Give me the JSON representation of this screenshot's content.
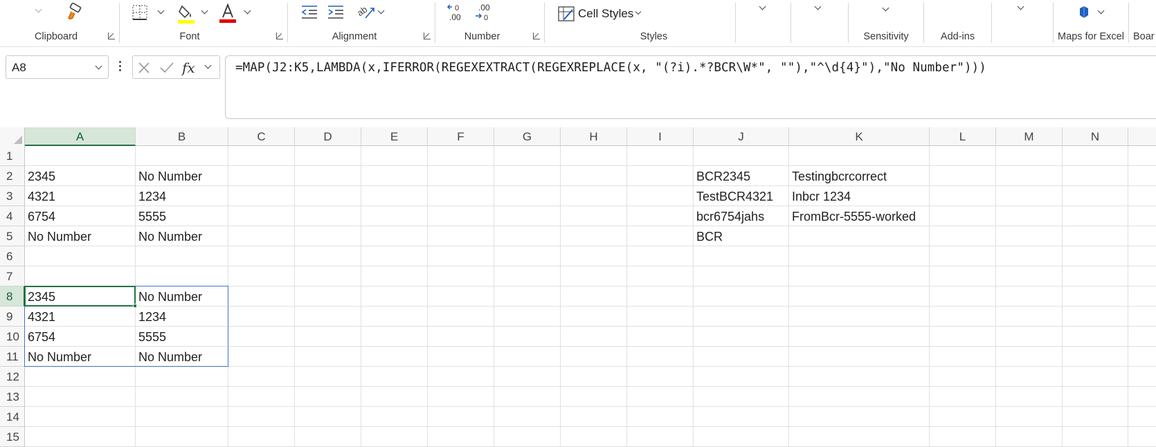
{
  "ribbon": {
    "groups": {
      "clipboard": "Clipboard",
      "font": "Font",
      "alignment": "Alignment",
      "number": "Number",
      "styles": "Styles",
      "sensitivity": "Sensitivity",
      "addins": "Add-ins",
      "maps": "Maps for Excel",
      "board": "Boar"
    },
    "cell_styles_label": "Cell Styles",
    "number_decimal_increase": ".00",
    "number_decimal_decrease": ".00",
    "colors": {
      "highlight": "#ffff00",
      "font_color": "#e00000"
    }
  },
  "formula_bar": {
    "name_box": "A8",
    "formula": "=MAP(J2:K5,LAMBDA(x,IFERROR(REGEXEXTRACT(REGEXREPLACE(x, \"(?i).*?BCR\\W*\", \"\"),\"^\\d{4}\"),\"No Number\")))"
  },
  "grid": {
    "columns": [
      "A",
      "B",
      "C",
      "D",
      "E",
      "F",
      "G",
      "H",
      "I",
      "J",
      "K",
      "L",
      "M",
      "N"
    ],
    "rows": [
      "1",
      "2",
      "3",
      "4",
      "5",
      "6",
      "7",
      "8",
      "9",
      "10",
      "11",
      "12",
      "13",
      "14",
      "15"
    ],
    "selected_column": "A",
    "selected_row": "8",
    "cells": {
      "A2": "2345",
      "B2": "No Number",
      "A3": "4321",
      "B3": "1234",
      "A4": "6754",
      "B4": "5555",
      "A5": "No Number",
      "B5": "No Number",
      "A8": "2345",
      "B8": "No Number",
      "A9": "4321",
      "B9": "1234",
      "A10": "6754",
      "B10": "5555",
      "A11": "No Number",
      "B11": "No Number",
      "J2": "BCR2345",
      "K2": "Testingbcrcorrect",
      "J3": "TestBCR4321",
      "K3": "Inbcr 1234",
      "J4": "bcr6754jahs",
      "K4": "FromBcr-5555-worked",
      "J5": "BCR"
    }
  }
}
